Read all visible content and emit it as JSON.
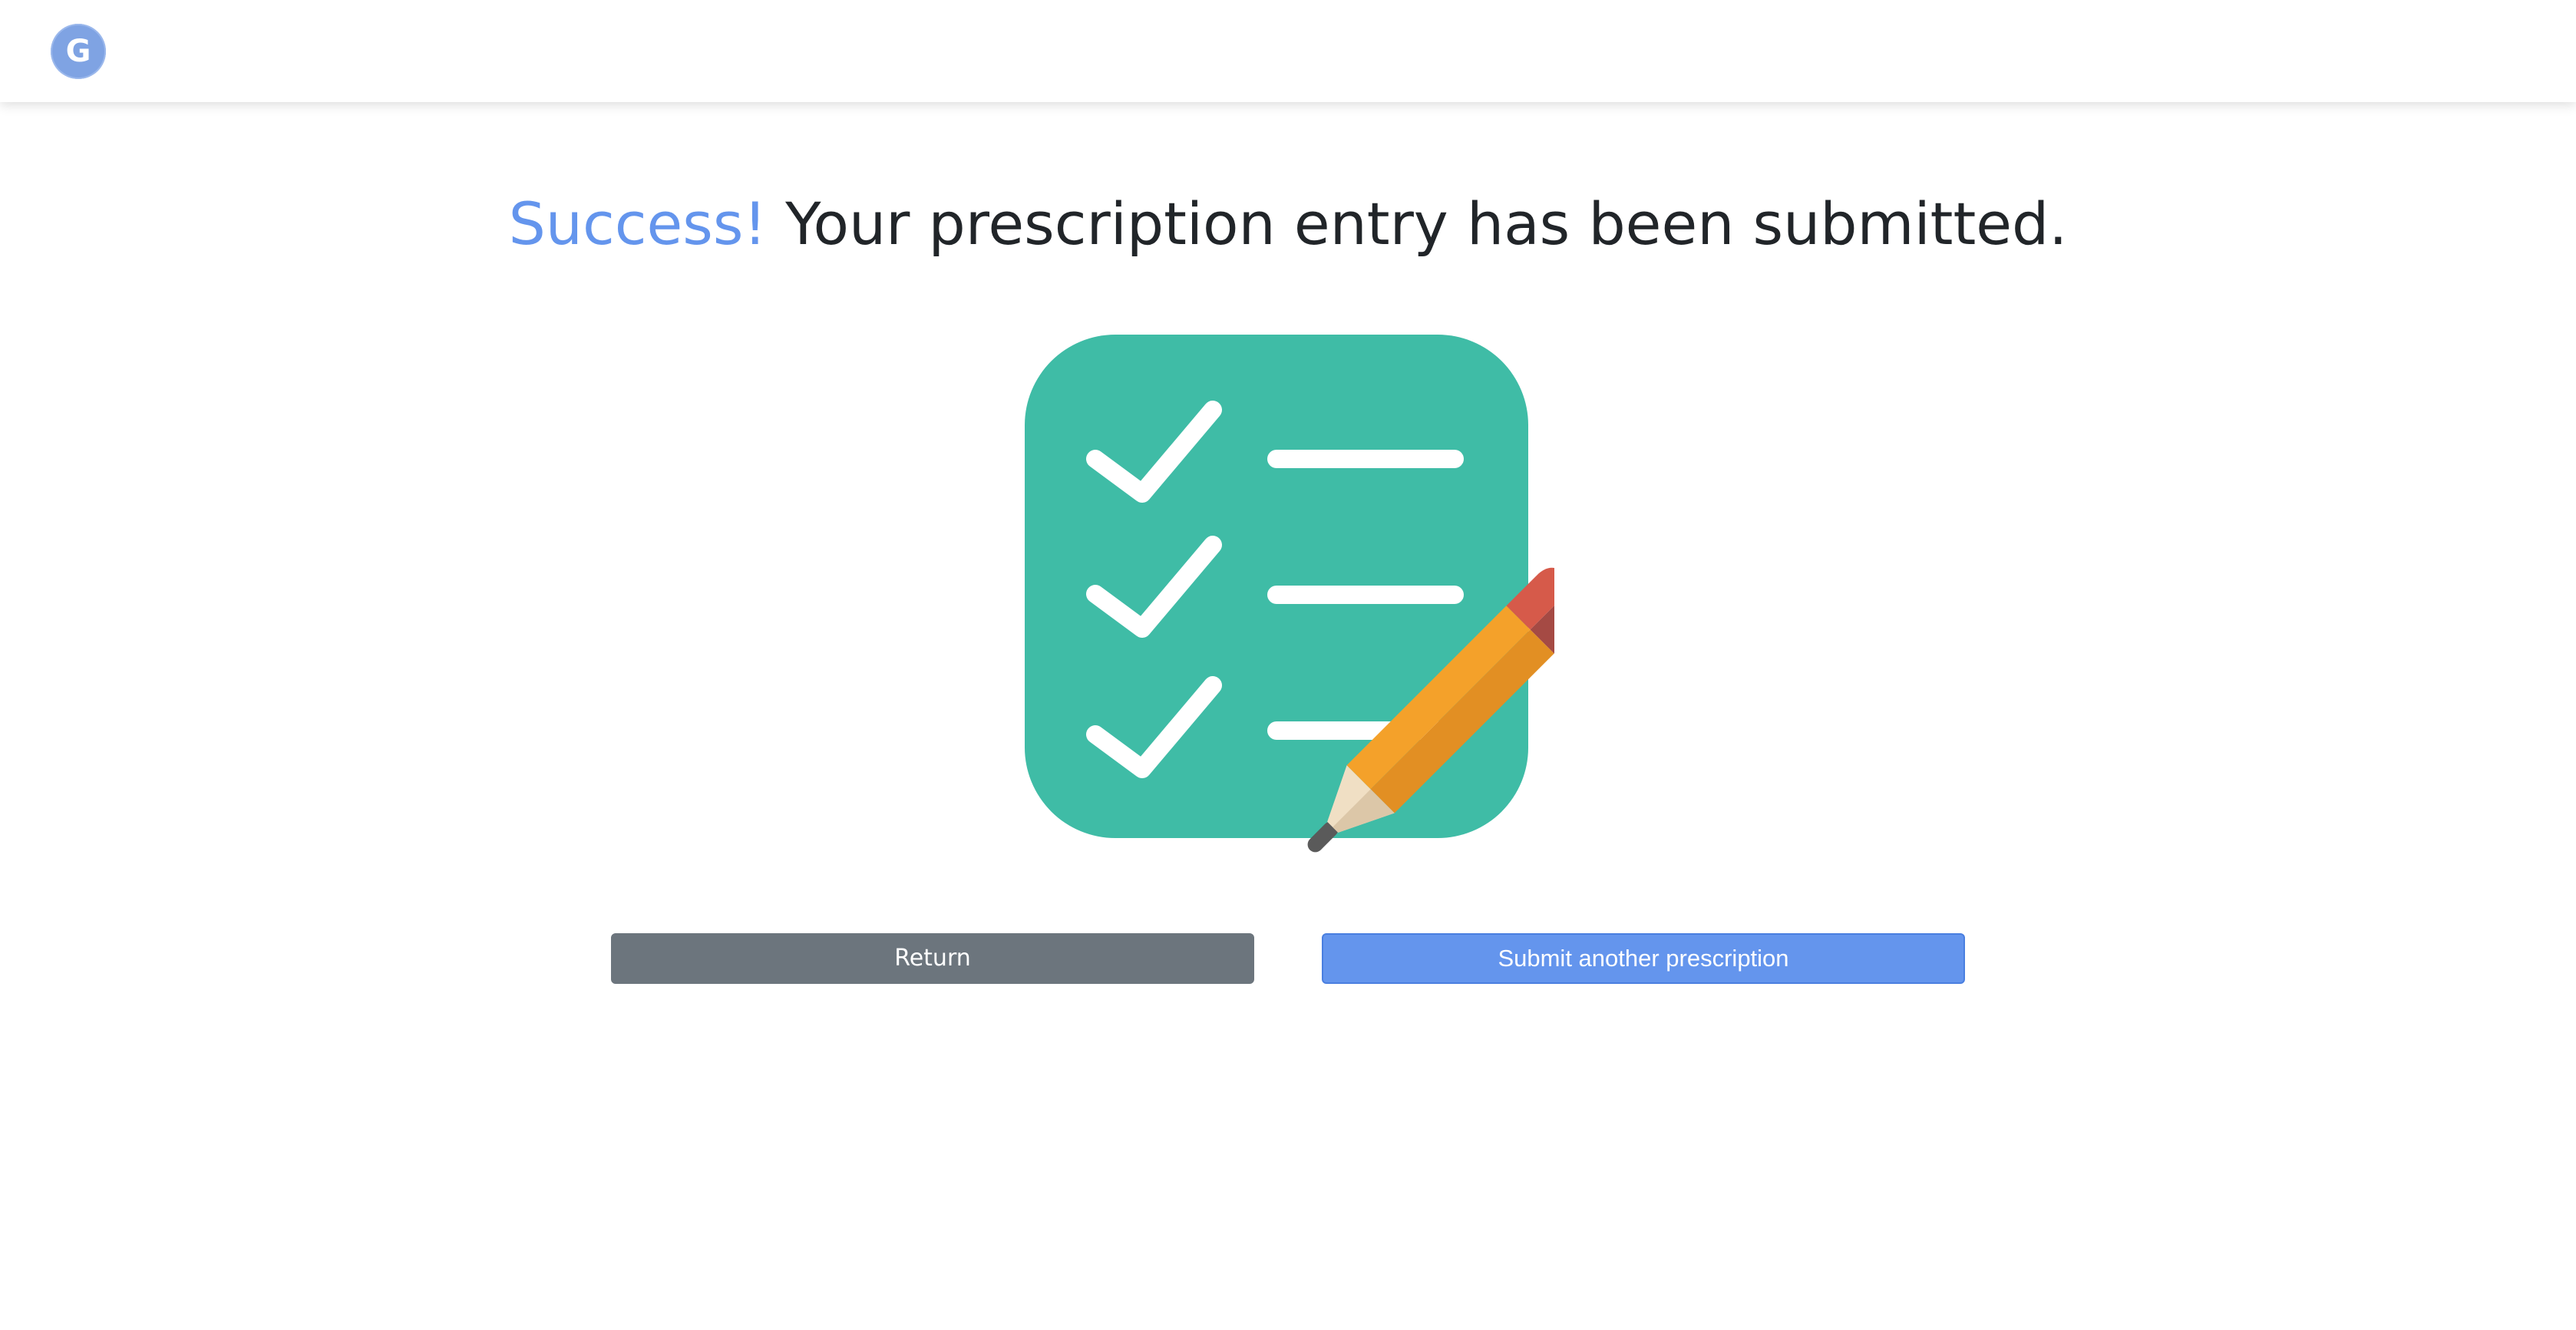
{
  "header": {
    "logo_letter": "G",
    "logo_color": "#7fa3e3"
  },
  "message": {
    "success_word": "Success!",
    "text": "Your prescription entry has been submitted."
  },
  "illustration": {
    "icon": "checklist-with-pencil-icon",
    "board_color": "#3fbca6"
  },
  "actions": {
    "return_label": "Return",
    "submit_another_label": "Submit another prescription"
  },
  "colors": {
    "accent": "#6495ed",
    "secondary": "#6c757d"
  }
}
